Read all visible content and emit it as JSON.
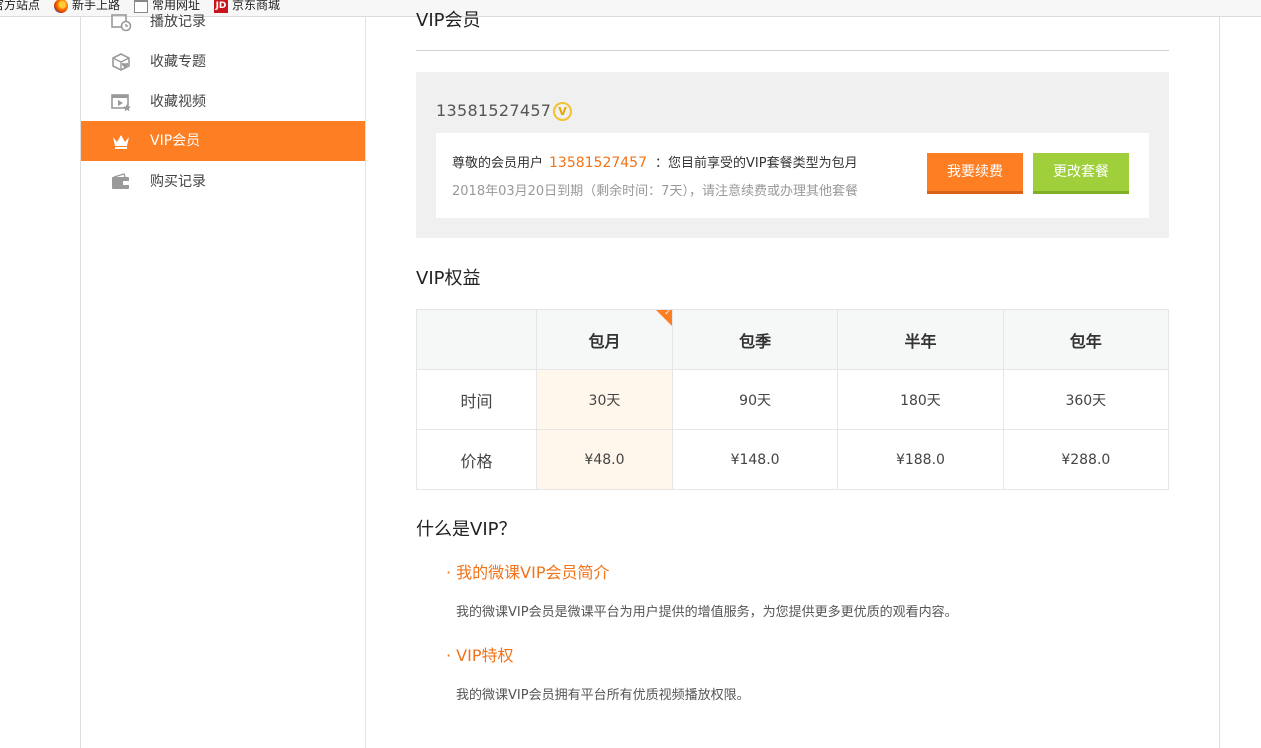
{
  "bookmarks": [
    {
      "label": "官方站点",
      "icon": "none"
    },
    {
      "label": "新手上路",
      "icon": "firefox-icon"
    },
    {
      "label": "常用网址",
      "icon": "folder-icon"
    },
    {
      "label": "京东商城",
      "icon": "jd-icon",
      "icon_text": "JD"
    }
  ],
  "sidebar": {
    "items": [
      {
        "label": "播放记录",
        "icon": "play-history-icon"
      },
      {
        "label": "收藏专题",
        "icon": "favorite-topic-icon"
      },
      {
        "label": "收藏视频",
        "icon": "favorite-video-icon"
      },
      {
        "label": "VIP会员",
        "icon": "crown-icon",
        "active": true
      },
      {
        "label": "购买记录",
        "icon": "wallet-icon"
      }
    ],
    "active_color": "#fd7e23"
  },
  "main": {
    "title": "VIP会员",
    "member": {
      "phone": "13581527457",
      "badge": "V",
      "greeting_prefix": "尊敬的会员用户",
      "greeting_phone": "13581527457",
      "greeting_suffix": "：您目前享受的VIP套餐类型为包月",
      "expiry": "2018年03月20日到期（剩余时间：7天），请注意续费或办理其他套餐",
      "renew_button": "我要续费",
      "change_button": "更改套餐"
    },
    "benefits_title": "VIP权益",
    "table": {
      "plans": [
        "包月",
        "包季",
        "半年",
        "包年"
      ],
      "selected_plan_index": 0,
      "rows": [
        {
          "label": "时间",
          "values": [
            "30天",
            "90天",
            "180天",
            "360天"
          ]
        },
        {
          "label": "价格",
          "values": [
            "¥48.0",
            "¥148.0",
            "¥188.0",
            "¥288.0"
          ]
        }
      ]
    },
    "faq_title": "什么是VIP？",
    "faq": [
      {
        "q": "· 我的微课VIP会员简介",
        "a": "我的微课VIP会员是微课平台为用户提供的增值服务，为您提供更多更优质的观看内容。"
      },
      {
        "q": "· VIP特权",
        "a": "我的微课VIP会员拥有平台所有优质视频播放权限。"
      }
    ]
  },
  "colors": {
    "accent": "#fd7e23",
    "green": "#9fd03c",
    "highlight_text": "#f27318"
  }
}
